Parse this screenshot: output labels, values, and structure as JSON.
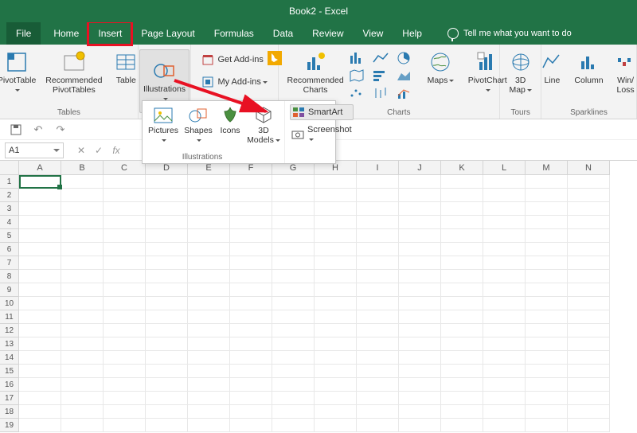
{
  "title": "Book2 - Excel",
  "tabs": {
    "file": "File",
    "home": "Home",
    "insert": "Insert",
    "pagelayout": "Page Layout",
    "formulas": "Formulas",
    "data": "Data",
    "review": "Review",
    "view": "View",
    "help": "Help"
  },
  "tellme": "Tell me what you want to do",
  "ribbon": {
    "tables": {
      "pivot": "PivotTable",
      "recommended": "Recommended\nPivotTables",
      "table": "Table",
      "label": "Tables"
    },
    "illustrations": {
      "btn": "Illustrations"
    },
    "addins": {
      "get": "Get Add-ins",
      "my": "My Add-ins"
    },
    "chartsGroup": {
      "recommended": "Recommended\nCharts",
      "maps": "Maps",
      "pivotchart": "PivotChart",
      "label": "Charts"
    },
    "tours": {
      "map": "3D\nMap",
      "label": "Tours"
    },
    "sparklines": {
      "line": "Line",
      "column": "Column",
      "winloss": "Win/\nLoss",
      "label": "Sparklines"
    }
  },
  "popout": {
    "pictures": "Pictures",
    "shapes": "Shapes",
    "icons": "Icons",
    "models": "3D\nModels",
    "smartart": "SmartArt",
    "screenshot": "Screenshot",
    "label": "Illustrations"
  },
  "namebox": "A1",
  "columns": [
    "A",
    "B",
    "C",
    "D",
    "E",
    "F",
    "G",
    "H",
    "I",
    "J",
    "K",
    "L",
    "M",
    "N"
  ],
  "rows": [
    "1",
    "2",
    "3",
    "4",
    "5",
    "6",
    "7",
    "8",
    "9",
    "10",
    "11",
    "12",
    "13",
    "14",
    "15",
    "16",
    "17",
    "18",
    "19"
  ]
}
